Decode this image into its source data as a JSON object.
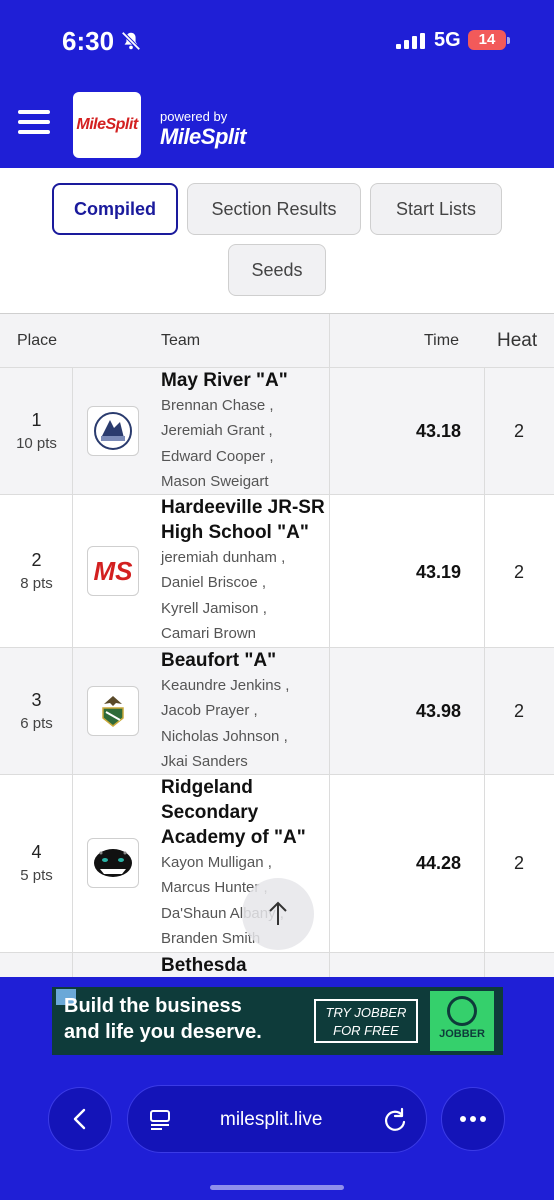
{
  "status_bar": {
    "time": "6:30",
    "network": "5G",
    "battery": "14"
  },
  "header": {
    "logo_text": "MileSplit",
    "powered_by": "powered by",
    "powered_brand": "MileSplit"
  },
  "tabs": [
    {
      "label": "Compiled",
      "active": true
    },
    {
      "label": "Section Results",
      "active": false
    },
    {
      "label": "Start Lists",
      "active": false
    },
    {
      "label": "Seeds",
      "active": false
    }
  ],
  "table": {
    "headers": {
      "place": "Place",
      "team": "Team",
      "time": "Time",
      "heat": "Heat"
    },
    "rows": [
      {
        "place": "1",
        "points": "10 pts",
        "team": "May River \"A\"",
        "athletes": [
          "Brennan Chase ,",
          "Jeremiah Grant ,",
          "Edward Cooper ,",
          "Mason Sweigart"
        ],
        "time": "43.18",
        "heat": "2"
      },
      {
        "place": "2",
        "points": "8 pts",
        "team": "Hardeeville JR-SR High School \"A\"",
        "athletes": [
          "jeremiah dunham ,",
          "Daniel Briscoe ,",
          "Kyrell Jamison ,",
          "Camari Brown"
        ],
        "time": "43.19",
        "heat": "2",
        "logo_text": "MS"
      },
      {
        "place": "3",
        "points": "6 pts",
        "team": "Beaufort \"A\"",
        "athletes": [
          "Keaundre Jenkins ,",
          "Jacob Prayer ,",
          "Nicholas Johnson ,",
          "Jkai Sanders"
        ],
        "time": "43.98",
        "heat": "2"
      },
      {
        "place": "4",
        "points": "5 pts",
        "team": "Ridgeland Secondary Academy of \"A\"",
        "athletes": [
          "Kayon Mulligan ,",
          "Marcus Hunter ,",
          "Da'Shaun Albany ,",
          "Branden Smith"
        ],
        "time": "44.28",
        "heat": "2"
      },
      {
        "team": "Bethesda"
      }
    ]
  },
  "ad": {
    "line1": "Build the business",
    "line2": "and life you deserve.",
    "cta": "TRY JOBBER FOR FREE",
    "brand": "JOBBER"
  },
  "browser": {
    "url": "milesplit.live"
  }
}
